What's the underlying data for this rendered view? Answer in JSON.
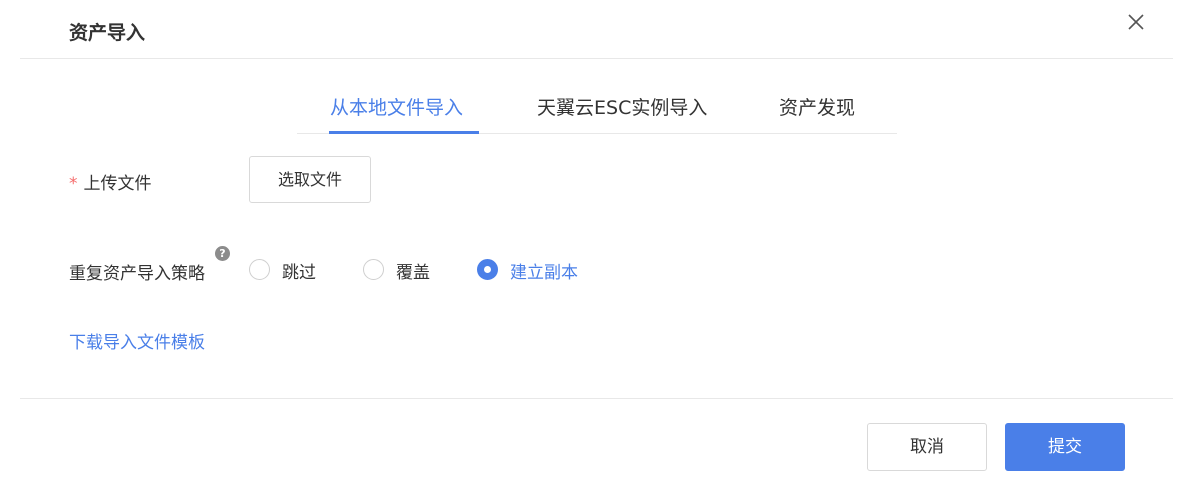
{
  "dialog": {
    "title": "资产导入"
  },
  "tabs": [
    {
      "label": "从本地文件导入",
      "active": true
    },
    {
      "label": "天翼云ESC实例导入",
      "active": false
    },
    {
      "label": "资产发现",
      "active": false
    }
  ],
  "upload": {
    "required_mark": "*",
    "label": "上传文件",
    "button_label": "选取文件"
  },
  "strategy": {
    "label": "重复资产导入策略",
    "help_icon": "?",
    "options": [
      {
        "label": "跳过",
        "checked": false
      },
      {
        "label": "覆盖",
        "checked": false
      },
      {
        "label": "建立副本",
        "checked": true
      }
    ]
  },
  "download_template_link": "下载导入文件模板",
  "footer": {
    "cancel_label": "取消",
    "submit_label": "提交"
  },
  "colors": {
    "primary": "#4a7fe8",
    "required": "#f56c6c",
    "text": "#333333",
    "border": "#d9d9d9"
  },
  "icons": {
    "close": "close-icon",
    "help": "question-circle-icon"
  }
}
